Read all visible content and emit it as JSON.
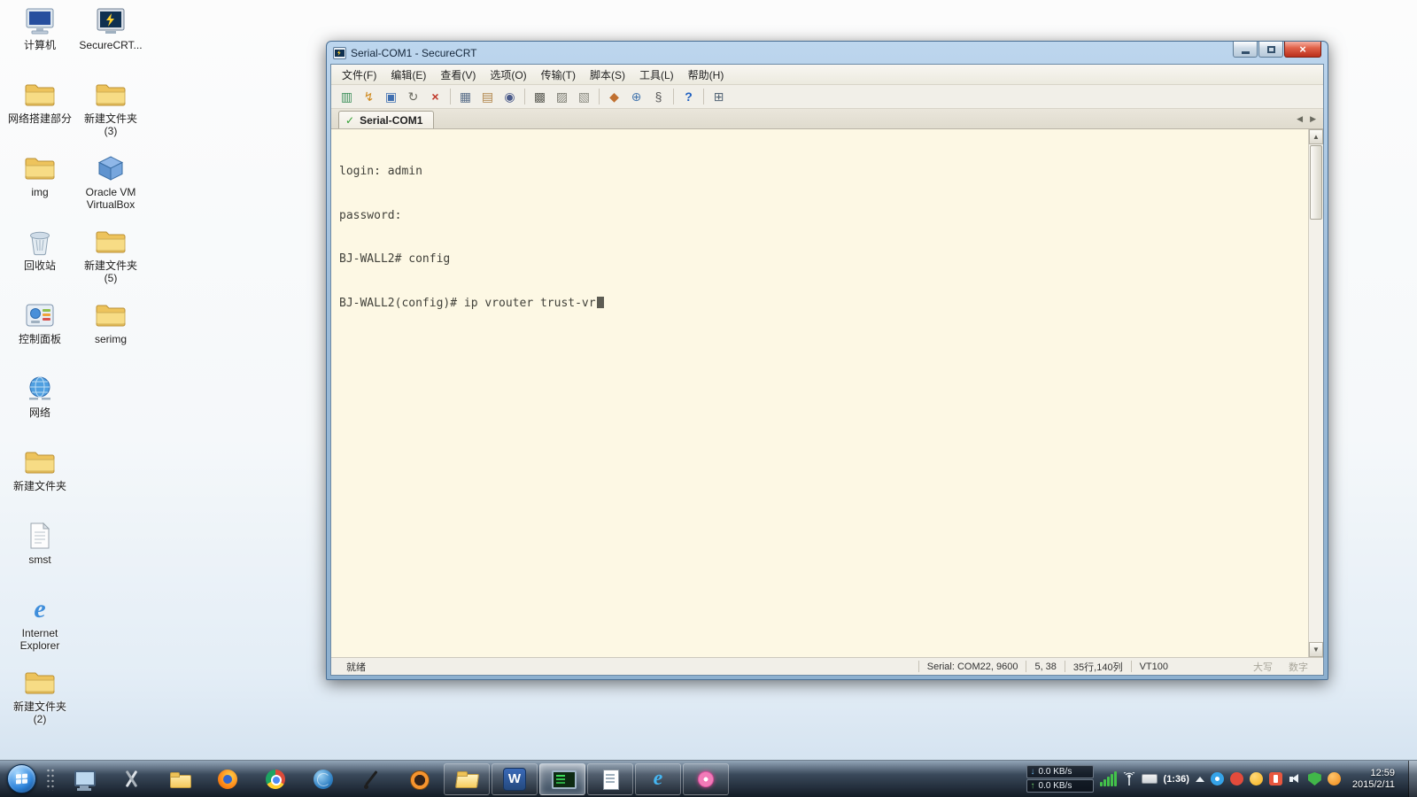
{
  "desktop": {
    "icons": [
      {
        "label": "计算机",
        "type": "computer"
      },
      {
        "label": "网络搭建部分",
        "type": "folder"
      },
      {
        "label": "img",
        "type": "folder"
      },
      {
        "label": "回收站",
        "type": "recycle-bin"
      },
      {
        "label": "控制面板",
        "type": "control-panel"
      },
      {
        "label": "网络",
        "type": "network"
      },
      {
        "label": "新建文件夹",
        "type": "folder"
      },
      {
        "label": "smst",
        "type": "file"
      },
      {
        "label": "Internet Explorer",
        "type": "internet-explorer",
        "letter": "e"
      },
      {
        "label": "新建文件夹 (2)",
        "type": "folder"
      },
      {
        "label": "SecureCRT...",
        "type": "securecrt"
      },
      {
        "label": "新建文件夹 (3)",
        "type": "folder"
      },
      {
        "label": "Oracle VM VirtualBox",
        "type": "virtualbox"
      },
      {
        "label": "新建文件夹 (5)",
        "type": "folder"
      },
      {
        "label": "serimg",
        "type": "folder"
      }
    ]
  },
  "window": {
    "title": "Serial-COM1 - SecureCRT",
    "controls": {
      "close_glyph": "×"
    },
    "menu": [
      "文件(F)",
      "编辑(E)",
      "查看(V)",
      "选项(O)",
      "传输(T)",
      "脚本(S)",
      "工具(L)",
      "帮助(H)"
    ],
    "toolbar": [
      {
        "name": "connect",
        "glyph": "▥"
      },
      {
        "name": "quick-connect",
        "glyph": "↯"
      },
      {
        "name": "connect-in-tab",
        "glyph": "▣"
      },
      {
        "name": "reconnect",
        "glyph": "↻"
      },
      {
        "name": "disconnect",
        "glyph": "×"
      },
      {
        "name": "copy",
        "glyph": "▦"
      },
      {
        "name": "paste",
        "glyph": "▤"
      },
      {
        "name": "find",
        "glyph": "◉"
      },
      {
        "name": "print",
        "glyph": "▩"
      },
      {
        "name": "auto-print",
        "glyph": "▨"
      },
      {
        "name": "print-setup",
        "glyph": "▧"
      },
      {
        "name": "session-options",
        "glyph": "◆"
      },
      {
        "name": "global-options",
        "glyph": "⊕"
      },
      {
        "name": "run-script",
        "glyph": "§"
      },
      {
        "name": "help",
        "glyph": "?"
      },
      {
        "name": "session-manager",
        "glyph": "⊞"
      }
    ],
    "tab": {
      "label": "Serial-COM1",
      "check_glyph": "✓"
    },
    "tab_nav": {
      "left": "◀",
      "right": "▶"
    },
    "scrollbar": {
      "up": "▲",
      "down": "▼"
    },
    "terminal": {
      "lines": [
        "login: admin",
        "password:",
        "BJ-WALL2# config",
        "BJ-WALL2(config)# ip vrouter trust-vr"
      ]
    },
    "status": {
      "ready": "就绪",
      "serial": "Serial: COM22, 9600",
      "cursor_pos": "5, 38",
      "screen_size": "35行,140列",
      "emulation": "VT100",
      "caps": "大写",
      "num": "数字"
    }
  },
  "taskbar": {
    "apps": [
      {
        "name": "remote-desktop"
      },
      {
        "name": "snipping-tool"
      },
      {
        "name": "documents-folder"
      },
      {
        "name": "firefox"
      },
      {
        "name": "chrome"
      },
      {
        "name": "browser"
      },
      {
        "name": "pen-tool"
      },
      {
        "name": "media-player"
      },
      {
        "name": "windows-explorer"
      },
      {
        "name": "word",
        "letter": "W"
      },
      {
        "name": "securecrt"
      },
      {
        "name": "notepad"
      },
      {
        "name": "internet-explorer",
        "letter": "e"
      },
      {
        "name": "paint-flower"
      }
    ],
    "tray": {
      "down_arrow": "↓",
      "down_speed": "0.0 KB/s",
      "up_arrow": "↑",
      "up_speed": "0.0 KB/s",
      "timer": "(1:36)",
      "time": "12:59",
      "date": "2015/2/11"
    }
  }
}
